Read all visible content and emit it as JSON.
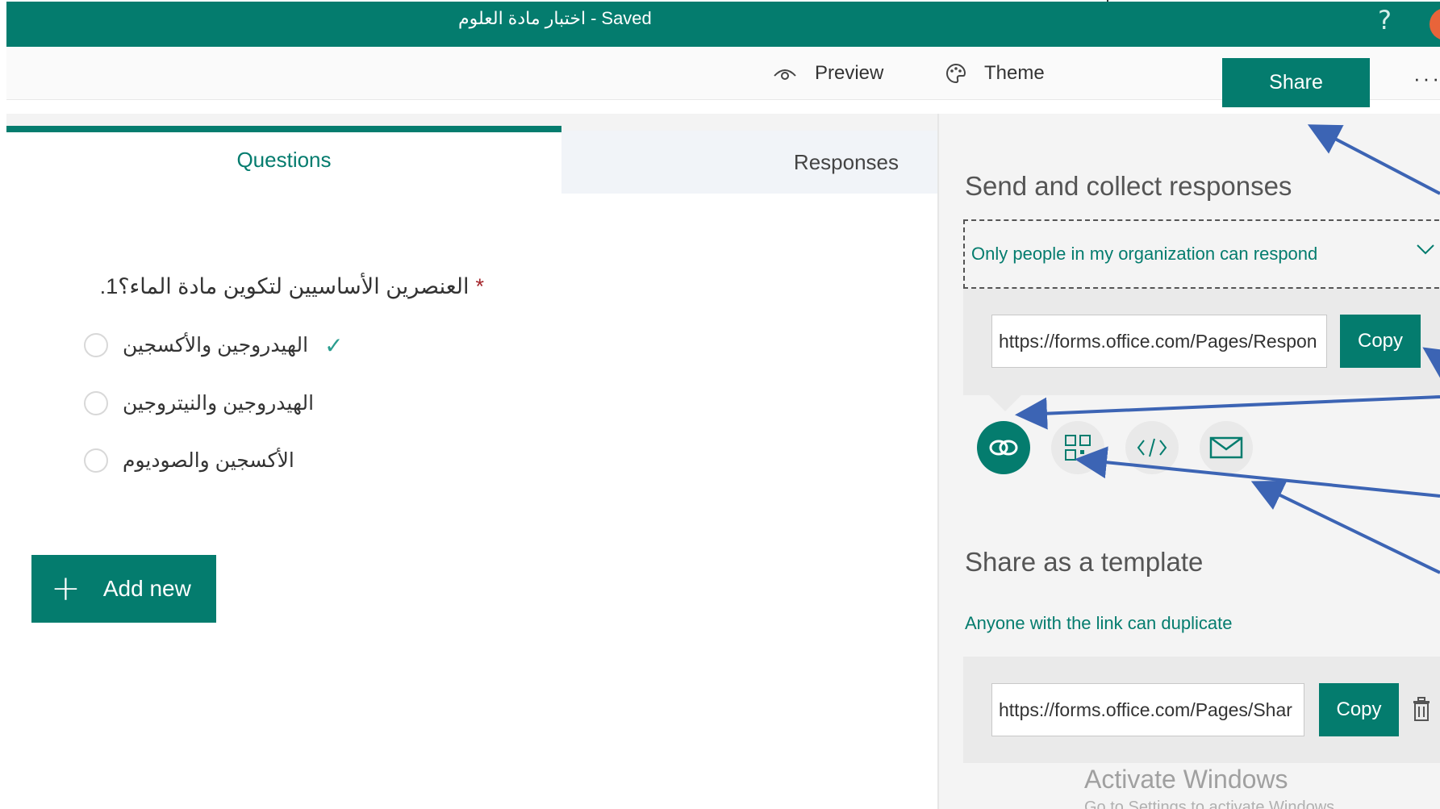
{
  "header": {
    "title": "اختبار مادة العلوم",
    "separator": "-",
    "status": "Saved",
    "help_label": "?"
  },
  "toolbar": {
    "preview_label": "Preview",
    "theme_label": "Theme",
    "share_label": "Share",
    "more_label": "···"
  },
  "tabs": {
    "questions_label": "Questions",
    "responses_label": "Responses"
  },
  "question": {
    "number": "1.",
    "text": "العنصرين الأساسيين لتكوين مادة الماء؟",
    "required_mark": "*",
    "options": [
      {
        "text": "الهيدروجين والأكسجين",
        "correct": true
      },
      {
        "text": "الهيدروجين والنيتروجين",
        "correct": false
      },
      {
        "text": "الأكسجين والصوديوم",
        "correct": false
      }
    ],
    "check_mark": "✓"
  },
  "add_new": {
    "plus": "+",
    "label": "Add new"
  },
  "share_panel": {
    "title": "Send and collect responses",
    "permission": "Only people in my organization can respond",
    "url": "https://forms.office.com/Pages/Respon",
    "copy_label": "Copy",
    "share_options": [
      "link-icon",
      "qr-code-icon",
      "embed-code-icon",
      "email-icon"
    ]
  },
  "template": {
    "title": "Share as a template",
    "link_text": "Anyone with the link can duplicate",
    "url": "https://forms.office.com/Pages/Shar",
    "copy_label": "Copy"
  },
  "watermark": {
    "title": "Activate Windows",
    "subtitle": "Go to Settings to activate Windows."
  },
  "colors": {
    "brand": "#047c6e",
    "annotation_arrow": "#3c64b4"
  }
}
